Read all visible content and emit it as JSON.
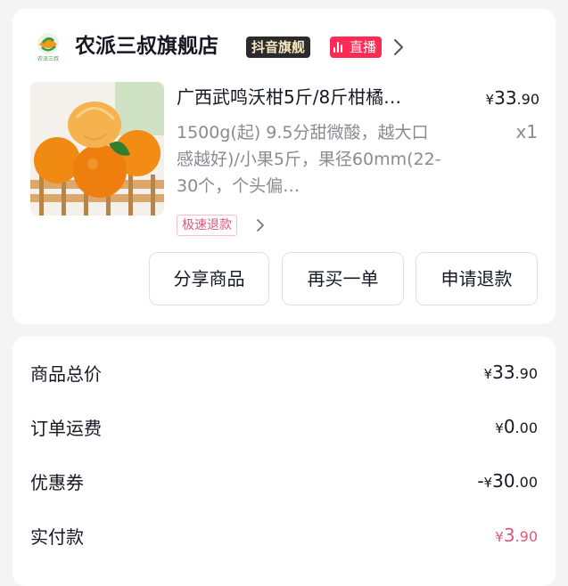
{
  "shop": {
    "name": "农派三叔旗舰店",
    "logo_text": "农派三叔",
    "flagship_badge": "抖音旗舰",
    "live_badge": "直播"
  },
  "product": {
    "title": "广西武鸣沃柑5斤/8斤柑橘…",
    "price_symbol": "¥",
    "price_int": "33",
    "price_dec": ".90",
    "spec": "1500g(起) 9.5分甜微酸，越大口感越好)/小果5斤，果径60mm(22-30个，个头偏…",
    "quantity": "x1",
    "refund_tag": "极速退款"
  },
  "actions": {
    "share_label": "分享商品",
    "rebuy_label": "再买一单",
    "refund_label": "申请退款"
  },
  "summary": {
    "rows": [
      {
        "label": "商品总价",
        "prefix": "",
        "symbol": "¥",
        "int": "33",
        "dec": ".90"
      },
      {
        "label": "订单运费",
        "prefix": "",
        "symbol": "¥",
        "int": "0",
        "dec": ".00"
      },
      {
        "label": "优惠券",
        "prefix": "-",
        "symbol": "¥",
        "int": "30",
        "dec": ".00"
      },
      {
        "label": "实付款",
        "prefix": "",
        "symbol": "¥",
        "int": "3",
        "dec": ".90"
      }
    ]
  },
  "colors": {
    "accent_pink": "#fe2c55",
    "paid_pink": "#e0577a",
    "badge_dark": "#2b2b2b",
    "muted_text": "#8a8b91"
  },
  "icons": {
    "shop_logo": "orange-leaf-logo-icon",
    "live": "live-bars-icon",
    "chevron": "chevron-right-icon"
  }
}
